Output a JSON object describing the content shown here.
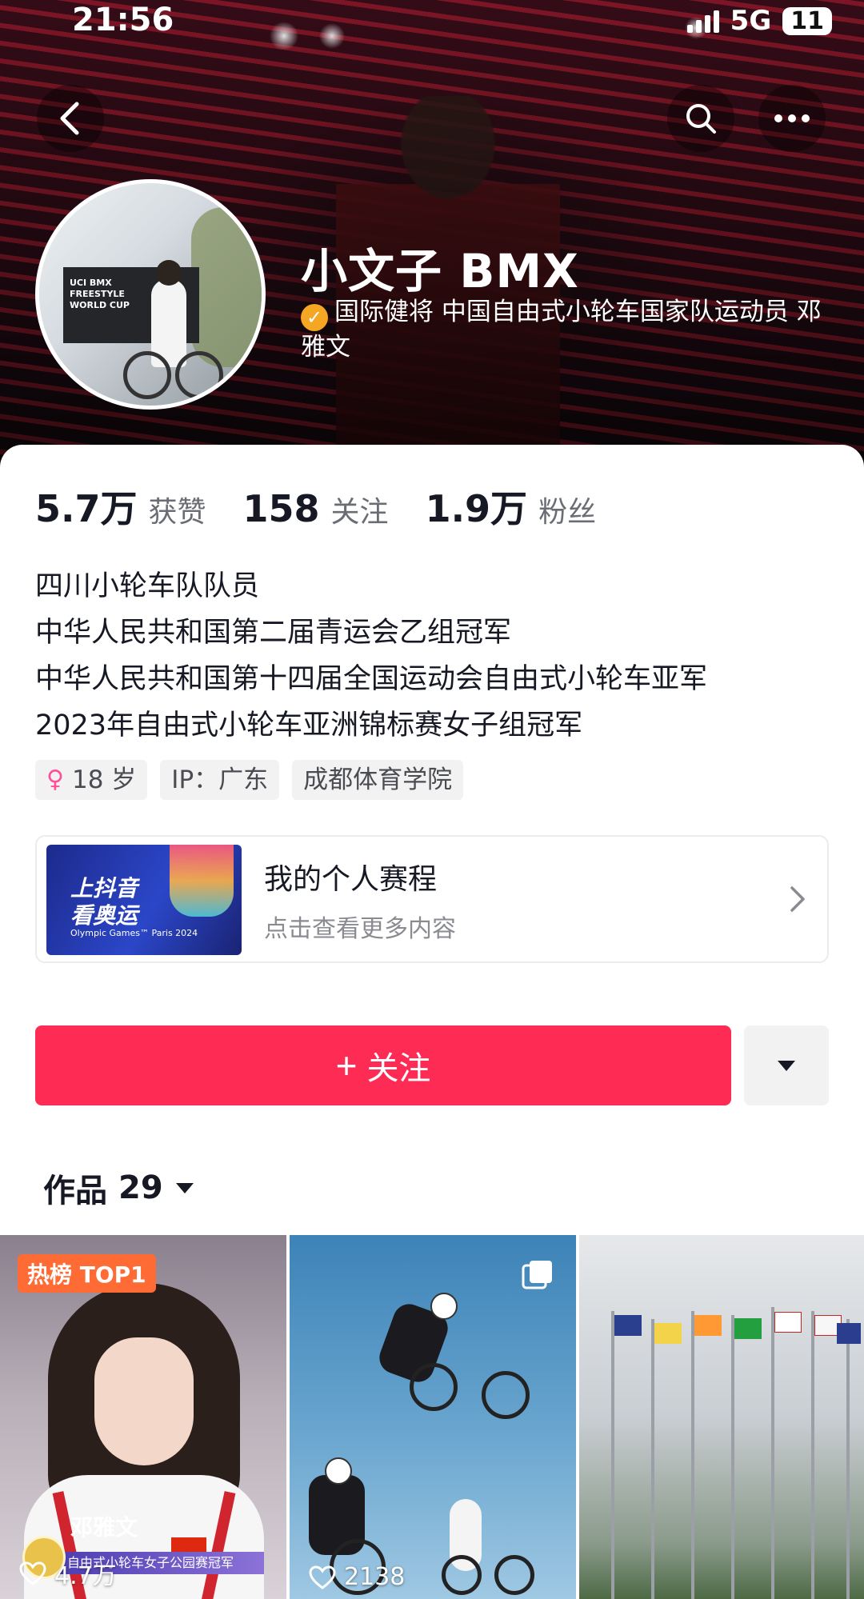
{
  "status_bar": {
    "time": "21:56",
    "network": "5G",
    "battery": "11"
  },
  "icons": {
    "back": "back-arrow-icon",
    "search": "search-icon",
    "more": "more-dots-icon"
  },
  "profile": {
    "name": "小文子 BMX",
    "verify_text": "国际健将 中国自由式小轮车国家队运动员 邓雅文",
    "avatar_panel_text": "UCI BMX FREESTYLE WORLD CUP"
  },
  "stats": [
    {
      "num": "5.7万",
      "label": "获赞"
    },
    {
      "num": "158",
      "label": "关注"
    },
    {
      "num": "1.9万",
      "label": "粉丝"
    }
  ],
  "bio": [
    "四川小轮车队队员",
    "中华人民共和国第二届青运会乙组冠军",
    "中华人民共和国第十四届全国运动会自由式小轮车亚军",
    "2023年自由式小轮车亚洲锦标赛女子组冠军"
  ],
  "tags": {
    "age": "18 岁",
    "ip": "IP：广东",
    "school": "成都体育学院"
  },
  "schedule": {
    "thumb_title_1": "上抖音",
    "thumb_title_2": "看奥运",
    "thumb_sub": "Olympic Games™ Paris 2024",
    "title": "我的个人赛程",
    "subtitle": "点击查看更多内容"
  },
  "actions": {
    "follow": "关注",
    "follow_plus": "+"
  },
  "works": {
    "label": "作品",
    "count": "29"
  },
  "grid": [
    {
      "badge": "热榜 TOP1",
      "likes": "4.7万",
      "banner_name": "邓雅文",
      "banner_sub": "自由式小轮车女子公园赛冠军"
    },
    {
      "likes": "2138"
    },
    {}
  ],
  "colors": {
    "accent": "#fe2c55",
    "badge": "#ff6b35",
    "verified": "#f5a623"
  }
}
